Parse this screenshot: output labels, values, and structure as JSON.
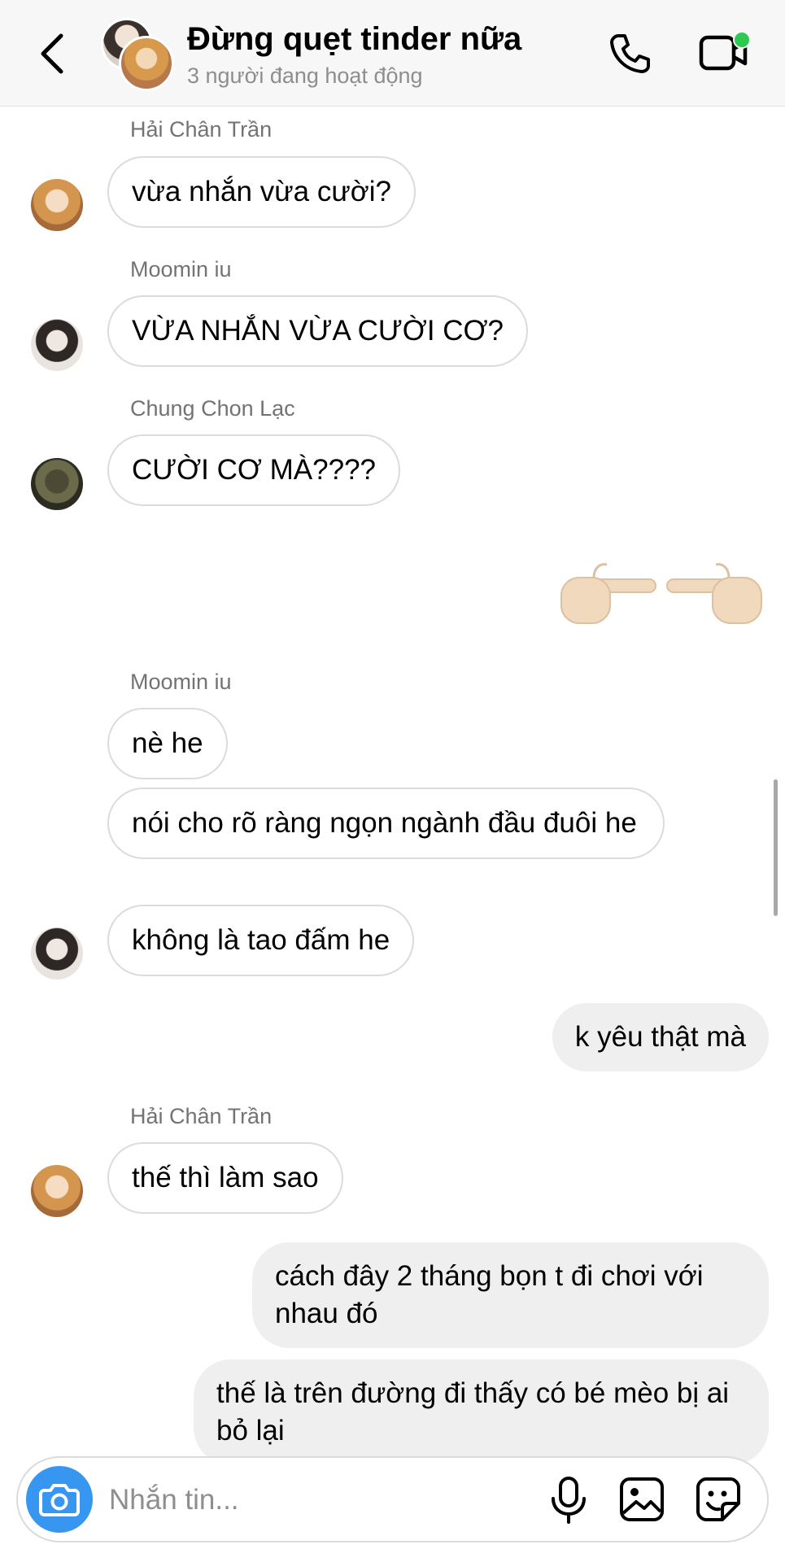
{
  "header": {
    "title": "Đừng quẹt tinder nữa",
    "status": "3 người đang hoạt động",
    "back_icon": "chevron-left-icon",
    "call_icon": "phone-icon",
    "video_icon": "video-camera-icon",
    "online_color": "#2ec950"
  },
  "messages": {
    "m1": {
      "sender": "Hải Chân Trần",
      "text": "vừa nhắn vừa cười?"
    },
    "m2": {
      "sender": "Moomin iu",
      "text": "VỪA NHẮN VỪA CƯỜI CƠ?"
    },
    "m3": {
      "sender": "Chung Chon Lạc",
      "text": "CƯỜI CƠ MÀ????"
    },
    "m4": {
      "emoji": "pointing-fingers-emoji"
    },
    "m5": {
      "sender": "Moomin iu",
      "texts": [
        "nè he",
        "nói cho rõ ràng ngọn ngành đầu đuôi he",
        "không là tao đấm he"
      ]
    },
    "m6": {
      "text": "k yêu thật mà"
    },
    "m7": {
      "sender": "Hải Chân Trần",
      "text": "thế thì làm sao"
    },
    "m8": {
      "text": "cách đây 2 tháng bọn t đi chơi với nhau đó"
    },
    "m9": {
      "text": "thế là trên đường đi thấy có bé mèo bị ai bỏ lại"
    }
  },
  "composer": {
    "placeholder": "Nhắn tin...",
    "camera_icon": "camera-icon",
    "mic_icon": "microphone-icon",
    "gallery_icon": "image-icon",
    "sticker_icon": "sticker-icon",
    "accent_color": "#3797f0"
  }
}
